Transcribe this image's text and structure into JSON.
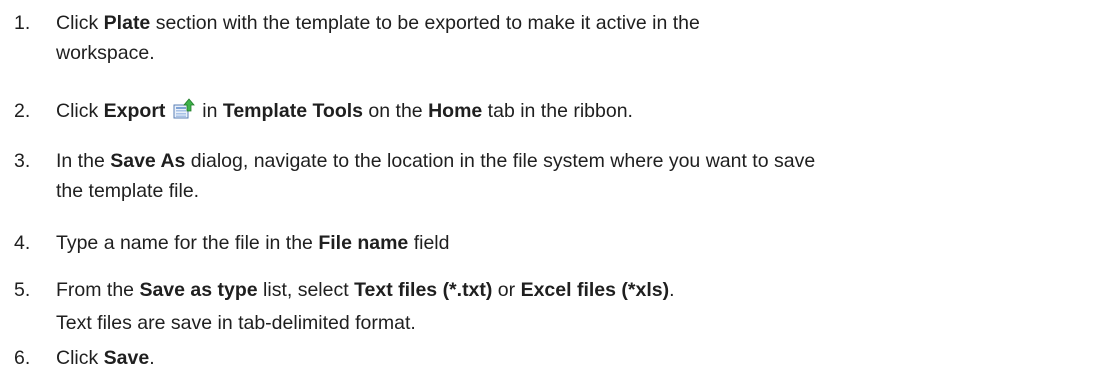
{
  "steps": [
    {
      "number": "1.",
      "parts": [
        "Click ",
        "Plate",
        " section with the template to be exported to make it active in the",
        "workspace."
      ]
    },
    {
      "number": "2.",
      "parts": [
        "Click ",
        "Export",
        " in ",
        "Template Tools",
        " on the ",
        "Home",
        " tab in the ribbon."
      ]
    },
    {
      "number": "3.",
      "parts": [
        "In the ",
        "Save As",
        " dialog, navigate to the location in the file system where you want to save",
        "the template file."
      ]
    },
    {
      "number": "4.",
      "parts": [
        "Type a name for the file in the ",
        "File name",
        " field"
      ]
    },
    {
      "number": "5.",
      "parts": [
        "From the ",
        "Save as type",
        " list, select ",
        "Text files (*.txt)",
        " or ",
        "Excel files (*xls)",
        "."
      ],
      "note": "Text files are save in tab-delimited format."
    },
    {
      "number": "6.",
      "parts": [
        "Click ",
        "Save",
        "."
      ]
    }
  ],
  "icons": {
    "export": "export-icon"
  }
}
